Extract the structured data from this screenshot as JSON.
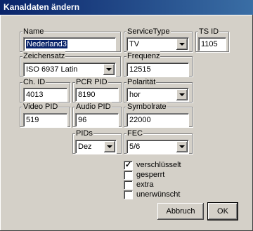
{
  "window": {
    "title": "Kanaldaten ändern"
  },
  "name": {
    "label": "Name",
    "value": "Nederland3"
  },
  "service_type": {
    "label": "ServiceType",
    "value": "TV"
  },
  "ts_id": {
    "label": "TS ID",
    "value": "1105"
  },
  "zeichensatz": {
    "label": "Zeichensatz",
    "value": "ISO 6937 Latin"
  },
  "frequenz": {
    "label": "Frequenz",
    "value": "12515"
  },
  "ch_id": {
    "label": "Ch. ID",
    "value": "4013"
  },
  "pcr_pid": {
    "label": "PCR PID",
    "value": "8190"
  },
  "polaritaet": {
    "label": "Polarität",
    "value": "hor"
  },
  "video_pid": {
    "label": "Video PID",
    "value": "519"
  },
  "audio_pid": {
    "label": "Audio PID",
    "value": "96"
  },
  "symbolrate": {
    "label": "Symbolrate",
    "value": "22000"
  },
  "pids": {
    "label": "PIDs",
    "value": "Dez"
  },
  "fec": {
    "label": "FEC",
    "value": "5/6"
  },
  "checkboxes": [
    {
      "label": "verschlüsselt",
      "checked": true,
      "mark": "✓"
    },
    {
      "label": "gesperrt",
      "checked": false,
      "mark": ""
    },
    {
      "label": "extra",
      "checked": false,
      "mark": ""
    },
    {
      "label": "unerwünscht",
      "checked": false,
      "mark": ""
    }
  ],
  "buttons": {
    "cancel": "Abbruch",
    "ok": "OK"
  },
  "colors": {
    "titlebar": "#0a246a",
    "face": "#d4d0c8",
    "selection": "#0a246a"
  }
}
